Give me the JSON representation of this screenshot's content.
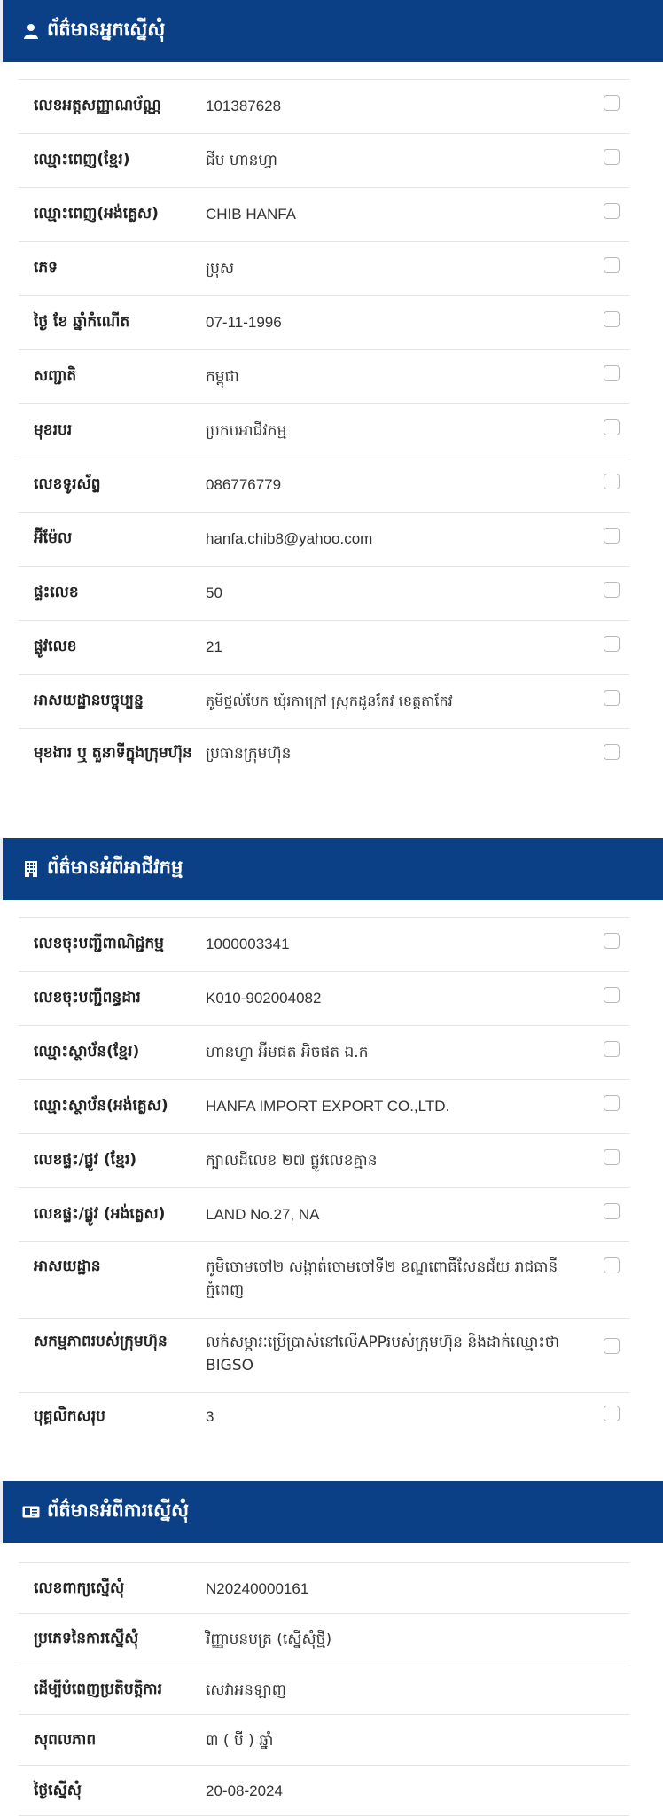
{
  "applicant": {
    "title": "ព័ត៌មានអ្នកស្នើសុំ",
    "rows": [
      {
        "label": "លេខអត្តសញ្ញាណប័ណ្ណ",
        "value": "101387628"
      },
      {
        "label": "ឈ្មោះពេញ(ខ្មែរ)",
        "value": "ជីប ហានហ្វា"
      },
      {
        "label": "ឈ្មោះពេញ(អង់គ្លេស)",
        "value": "CHIB HANFA"
      },
      {
        "label": "ភេទ",
        "value": "ប្រុស"
      },
      {
        "label": "ថ្ងៃ ខែ ឆ្នាំកំណើត",
        "value": "07-11-1996"
      },
      {
        "label": "សញ្ជាតិ",
        "value": "កម្ពុជា"
      },
      {
        "label": "មុខរបរ",
        "value": "ប្រកបអាជីវកម្ម"
      },
      {
        "label": "លេខទូរស័ព្ទ",
        "value": "086776779"
      },
      {
        "label": "អ៊ីម៉ែល",
        "value": "hanfa.chib8@yahoo.com"
      },
      {
        "label": "ផ្ទះលេខ",
        "value": "50"
      },
      {
        "label": "ផ្លូវលេខ",
        "value": "21"
      },
      {
        "label": "អាសយដ្ឋានបច្ចុប្បន្ន",
        "value": "ភូមិថ្នល់បែក ឃុំរកាក្រៅ ស្រុកដូនកែវ ខេត្តតាកែវ"
      },
      {
        "label": "មុខងារ ឬ តួនាទីក្នុងក្រុមហ៊ុន",
        "value": "ប្រធានក្រុមហ៊ុន"
      }
    ]
  },
  "business": {
    "title": "ព័ត៌មានអំពីអាជីវកម្ម",
    "rows": [
      {
        "label": "លេខចុះបញ្ជីពាណិជ្ជកម្ម",
        "value": "1000003341"
      },
      {
        "label": "លេខចុះបញ្ជីពន្ធដារ",
        "value": "K010-902004082"
      },
      {
        "label": "ឈ្មោះស្ថាប័ន(ខ្មែរ)",
        "value": "ហានហ្វា អ៊ីមផត អិចផត ឯ.ក"
      },
      {
        "label": "ឈ្មោះស្ថាប័ន(អង់គ្លេស)",
        "value": "HANFA IMPORT EXPORT CO.,LTD."
      },
      {
        "label": "លេខផ្ទះ/ផ្លូវ (ខ្មែរ)",
        "value": "ក្បាលដីលេខ ២៧ ផ្លូវលេខគ្មាន"
      },
      {
        "label": "លេខផ្ទះ/ផ្លូវ (អង់គ្លេស)",
        "value": "LAND No.27, NA"
      },
      {
        "label": "អាសយដ្ឋាន",
        "value": "ភូមិចោមចៅ២ សង្កាត់ចោមចៅទី២ ខណ្ឌពោធិ៍សែនជ័យ រាជធានីភ្នំពេញ"
      },
      {
        "label": "សកម្មភាពរបស់ក្រុមហ៊ុន",
        "value": "លក់សម្ភារៈប្រើប្រាស់នៅលើAPPរបស់ក្រុមហ៊ុន និងដាក់ឈ្មោះថា BIGSO"
      },
      {
        "label": "បុគ្គលិកសរុប",
        "value": "3"
      }
    ]
  },
  "request": {
    "title": "ព័ត៌មានអំពីការស្នើសុំ",
    "rows": [
      {
        "label": "លេខពាក្យស្នើសុំ",
        "value": "N20240000161"
      },
      {
        "label": "ប្រភេទនៃការស្នើសុំ",
        "value": "វិញ្ញាបនបត្រ (ស្នើសុំថ្មី)"
      },
      {
        "label": "ដើម្បីបំពេញប្រតិបត្តិការ",
        "value": "សេវាអនឡាញ"
      },
      {
        "label": "សុពលភាព",
        "value": "៣ ( បី ) ឆ្នាំ"
      },
      {
        "label": "ថ្ងៃស្នើសុំ",
        "value": "20-08-2024"
      }
    ]
  },
  "icons": {
    "applicant": "user-icon",
    "business": "building-icon",
    "request": "id-card-icon"
  },
  "colors": {
    "header_bg": "#0b3f86"
  }
}
